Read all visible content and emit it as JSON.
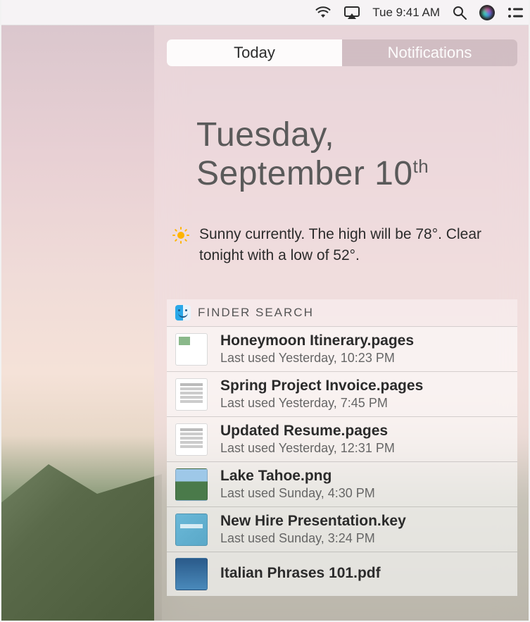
{
  "menubar": {
    "datetime": "Tue 9:41 AM"
  },
  "tabs": {
    "today": "Today",
    "notifications": "Notifications"
  },
  "date": {
    "line1": "Tuesday,",
    "line2_main": "September 10",
    "line2_sup": "th"
  },
  "weather": {
    "text": "Sunny currently. The high will be 78°.  Clear tonight with a low of 52°."
  },
  "widget": {
    "title": "FINDER SEARCH",
    "items": [
      {
        "name": "Honeymoon Itinerary.pages",
        "meta": "Last used Yesterday, 10:23 PM",
        "thumb": "itin"
      },
      {
        "name": "Spring Project Invoice.pages",
        "meta": "Last used Yesterday, 7:45 PM",
        "thumb": "doc"
      },
      {
        "name": "Updated Resume.pages",
        "meta": "Last used Yesterday, 12:31 PM",
        "thumb": "doc"
      },
      {
        "name": "Lake Tahoe.png",
        "meta": "Last used Sunday, 4:30 PM",
        "thumb": "photo"
      },
      {
        "name": "New Hire Presentation.key",
        "meta": "Last used Sunday, 3:24 PM",
        "thumb": "key"
      },
      {
        "name": "Italian Phrases 101.pdf",
        "meta": "",
        "thumb": "pdf"
      }
    ]
  }
}
